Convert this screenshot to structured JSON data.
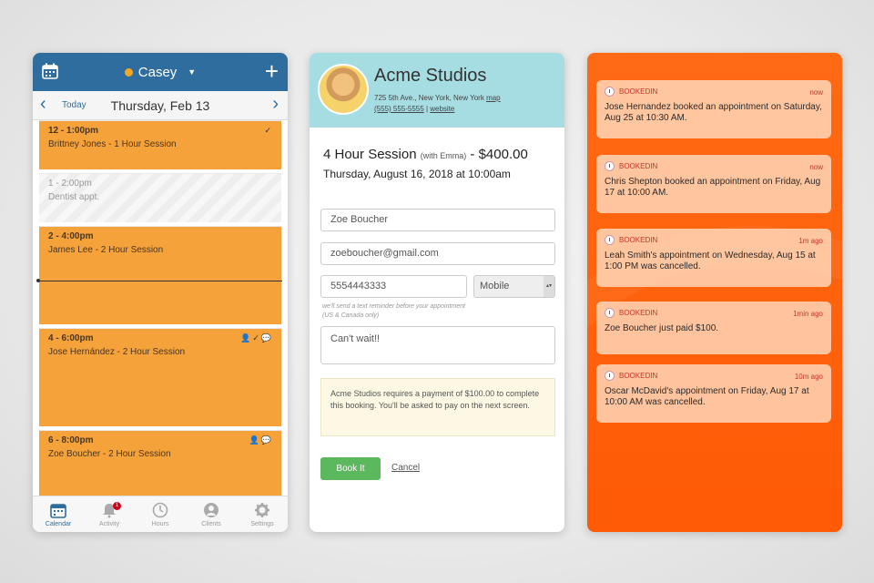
{
  "calendar": {
    "user": "Casey",
    "nav": {
      "today": "Today",
      "date": "Thursday, Feb 13"
    },
    "events": [
      {
        "time": "12 - 1:00pm",
        "title": "Brittney Jones - 1 Hour Session",
        "icons": "✓",
        "style": "booked"
      },
      {
        "time": "1 - 2:00pm",
        "title": "Dentist appt.",
        "icons": "",
        "style": "blocked"
      },
      {
        "time": "2 - 4:00pm",
        "title": "James Lee - 2 Hour Session",
        "icons": "",
        "style": "booked"
      },
      {
        "time": "4 - 6:00pm",
        "title": "Jose Hernández - 2 Hour Session",
        "icons": "👤✓💬",
        "style": "booked"
      },
      {
        "time": "6 - 8:00pm",
        "title": "Zoe Boucher - 2 Hour Session",
        "icons": "👤💬",
        "style": "booked"
      }
    ],
    "tabs": [
      {
        "label": "Calendar",
        "icon": "calendar-icon",
        "active": true
      },
      {
        "label": "Activity",
        "icon": "bell-icon",
        "badge": "1"
      },
      {
        "label": "Hours",
        "icon": "clock-icon"
      },
      {
        "label": "Clients",
        "icon": "person-icon"
      },
      {
        "label": "Settings",
        "icon": "gear-icon"
      }
    ],
    "colors": {
      "header": "#2f6d9e",
      "event": "#f5a23a",
      "user_dot": "#f5a623"
    }
  },
  "booking": {
    "studio": "Acme Studios",
    "address": "725 5th Ave., New York, New York",
    "map_link": "map",
    "phone": "(555) 555-5555",
    "website_link": "website",
    "session": "4 Hour Session",
    "with": "(with Emma)",
    "price": "- $400.00",
    "when": "Thursday, August 16, 2018 at 10:00am",
    "name_value": "Zoe Boucher",
    "email_value": "zoeboucher@gmail.com",
    "phone_value": "5554443333",
    "phone_type": "Mobile",
    "hint": "we'll send a text reminder before your appointment (US & Canada only)",
    "note_value": "Can't wait!!",
    "payment_notice": "Acme Studios requires a payment of $100.00 to complete this booking. You'll be asked to pay on the next screen.",
    "book_label": "Book It",
    "cancel_label": "Cancel",
    "colors": {
      "header": "#a6dde3",
      "book_button": "#5cb85c"
    }
  },
  "notifications": {
    "app": "BOOKEDIN",
    "items": [
      {
        "ago": "now",
        "message": "Jose Hernandez booked an appointment on Saturday, Aug 25 at 10:30 AM."
      },
      {
        "ago": "now",
        "message": "Chris Shepton booked an appointment on Friday, Aug 17 at 10:00 AM."
      },
      {
        "ago": "1m ago",
        "message": "Leah Smith's appointment on Wednesday, Aug 15 at 1:00 PM was cancelled."
      },
      {
        "ago": "1min ago",
        "message": "Zoe Boucher just paid $100."
      },
      {
        "ago": "10m ago",
        "message": "Oscar McDavid's appointment on Friday, Aug 17 at 10:00 AM was cancelled."
      }
    ],
    "colors": {
      "background": "#ff5f0a"
    }
  }
}
